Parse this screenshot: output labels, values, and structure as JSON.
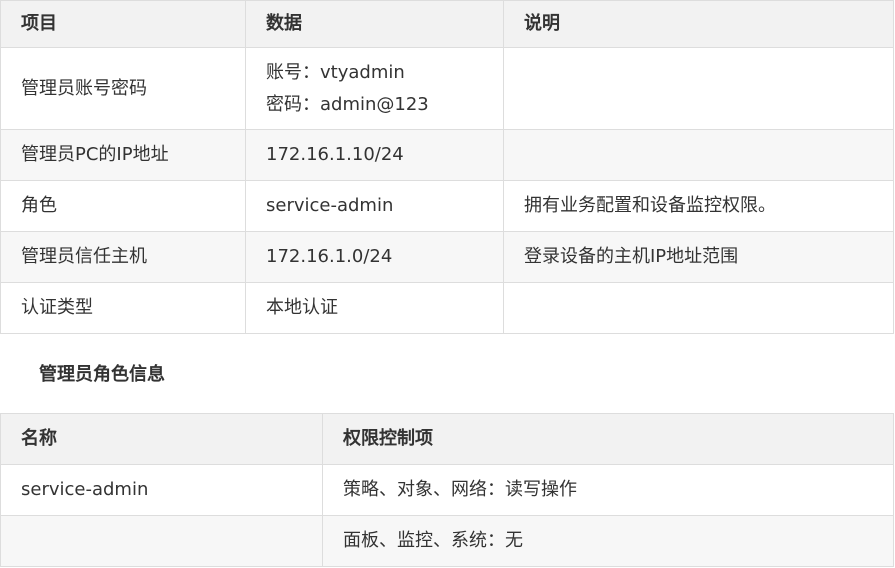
{
  "info_table": {
    "headers": [
      "项目",
      "数据",
      "说明"
    ],
    "rows": [
      {
        "item": "管理员账号密码",
        "data_lines": [
          "账号：vtyadmin",
          "密码：admin@123"
        ],
        "note": ""
      },
      {
        "item": "管理员PC的IP地址",
        "data": "172.16.1.10/24",
        "note": ""
      },
      {
        "item": "角色",
        "data": "service-admin",
        "note": "拥有业务配置和设备监控权限。"
      },
      {
        "item": "管理员信任主机",
        "data": "172.16.1.0/24",
        "note": "登录设备的主机IP地址范围"
      },
      {
        "item": "认证类型",
        "data": "本地认证",
        "note": ""
      }
    ]
  },
  "role_section": {
    "title": "管理员角色信息",
    "headers": [
      "名称",
      "权限控制项"
    ],
    "rows": [
      {
        "name": "service-admin",
        "permission": "策略、对象、网络：读写操作"
      },
      {
        "name": "",
        "permission": "面板、监控、系统：无"
      }
    ]
  },
  "colors": {
    "header_bg": "#f2f2f2",
    "alt_row_bg": "#f7f7f7",
    "border": "#dddddd",
    "text": "#333333"
  }
}
